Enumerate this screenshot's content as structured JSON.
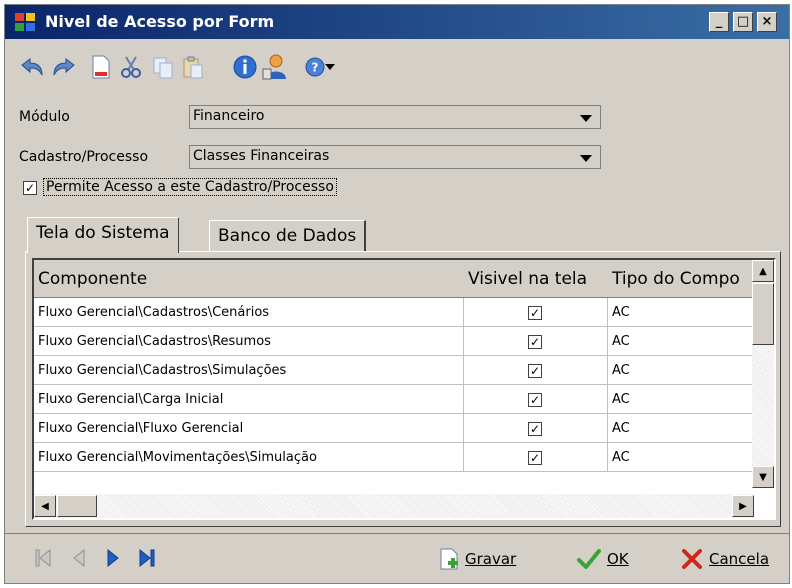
{
  "window": {
    "title": "Nivel de Acesso por Form"
  },
  "colors": {
    "title_bar_start": "#0a246a",
    "title_bar_end": "#3a6ea5",
    "face": "#d4d0c8",
    "nav_active": "#1f5fbf",
    "ok_green": "#3aa336",
    "cancel_red": "#d0271d"
  },
  "toolbar": {
    "icons": [
      "undo-icon",
      "redo-icon",
      "new-document-icon",
      "cut-icon",
      "copy-icon",
      "paste-icon",
      "info-icon",
      "user-access-icon",
      "help-icon",
      "dropdown-arrow-icon"
    ]
  },
  "form": {
    "modulo_label": "Módulo",
    "modulo_value": "Financeiro",
    "cadastro_label": "Cadastro/Processo",
    "cadastro_value": "Classes Financeiras",
    "permite_label": "Permite Acesso a este Cadastro/Processo",
    "permite_checked": true
  },
  "tabs": [
    {
      "label": "Tela do Sistema",
      "active": true
    },
    {
      "label": "Banco de Dados",
      "active": false
    }
  ],
  "grid": {
    "columns": [
      "Componente",
      "Visivel na tela",
      "Tipo do Compo"
    ],
    "rows": [
      {
        "componente": "Fluxo Gerencial\\Cadastros\\Cenários",
        "visivel": "✓",
        "tipo": "AC"
      },
      {
        "componente": "Fluxo Gerencial\\Cadastros\\Resumos",
        "visivel": "✓",
        "tipo": "AC"
      },
      {
        "componente": "Fluxo Gerencial\\Cadastros\\Simulações",
        "visivel": "✓",
        "tipo": "AC"
      },
      {
        "componente": "Fluxo Gerencial\\Carga Inicial",
        "visivel": "✓",
        "tipo": "AC"
      },
      {
        "componente": "Fluxo Gerencial\\Fluxo Gerencial",
        "visivel": "✓",
        "tipo": "AC"
      },
      {
        "componente": "Fluxo Gerencial\\Movimentações\\Simulação",
        "visivel": "✓",
        "tipo": "AC"
      }
    ]
  },
  "footer": {
    "gravar_label": "Gravar",
    "ok_label": "OK",
    "cancela_label": "Cancela"
  }
}
